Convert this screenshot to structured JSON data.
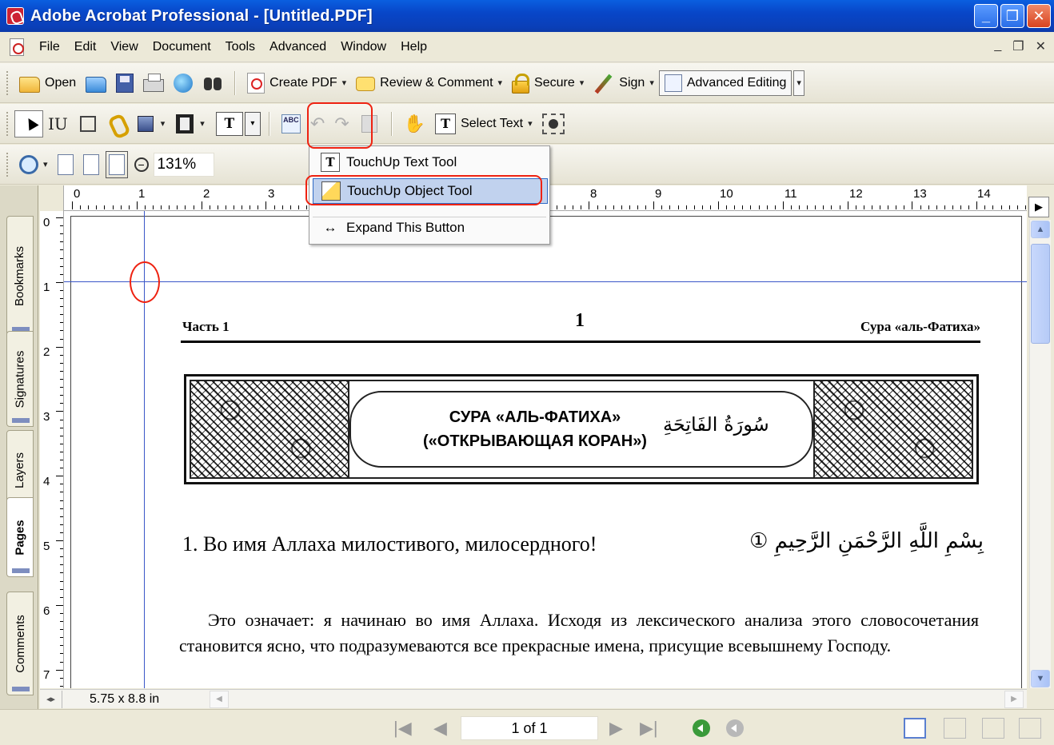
{
  "window": {
    "title": "Adobe Acrobat Professional - [Untitled.PDF]",
    "controls": {
      "minimize": "_",
      "restore": "❐",
      "close": "✕"
    }
  },
  "menu": [
    "File",
    "Edit",
    "View",
    "Document",
    "Tools",
    "Advanced",
    "Window",
    "Help"
  ],
  "mdi_controls": {
    "minimize": "_",
    "restore": "❐",
    "close": "✕"
  },
  "toolbar1": {
    "open": "Open",
    "create_pdf": "Create PDF",
    "review_comment": "Review & Comment",
    "secure": "Secure",
    "sign": "Sign",
    "advanced_editing": "Advanced Editing",
    "caret": "▾"
  },
  "toolbar2": {
    "select_text": "Select Text",
    "spell_label": "ABC"
  },
  "toolbar3": {
    "zoom_value": "131%"
  },
  "dropdown": {
    "items": [
      {
        "label": "TouchUp Text Tool",
        "icon": "T"
      },
      {
        "label": "TouchUp Object Tool",
        "icon": ""
      },
      {
        "label": "Expand This Button",
        "icon": "↔"
      }
    ]
  },
  "nav_tabs": [
    "Bookmarks",
    "Signatures",
    "Layers",
    "Pages",
    "Comments"
  ],
  "ruler": {
    "h_numbers": [
      "0",
      "1",
      "2",
      "3",
      "8",
      "9",
      "10",
      "11",
      "12",
      "13",
      "14"
    ],
    "v_numbers": [
      "0",
      "1",
      "2",
      "3",
      "4",
      "5",
      "6",
      "7"
    ]
  },
  "document": {
    "header_left": "Часть 1",
    "header_page": "1",
    "header_right": "Сура «аль-Фатиха»",
    "banner_line1": "СУРА «АЛЬ-ФАТИХА»",
    "banner_line2": "(«ОТКРЫВАЮЩАЯ КОРАН»)",
    "banner_arabic": "سُورَةُ الفَاتِحَةِ",
    "verse": "1. Во имя Аллаха милостивого, милосердного!",
    "verse_arabic": "بِسْمِ اللَّهِ الرَّحْمَنِ الرَّحِيمِ ①",
    "paragraph": "Это означает: я начинаю во имя Аллаха. Исходя из лексического анализа этого словосочетания становится ясно, что подразумеваются все прекрасные имена, присущие всевышнему Господу."
  },
  "status": {
    "page_size": "5.75 x 8.8 in",
    "page_of": "1 of 1"
  },
  "colors": {
    "titlebar": "#0846c8",
    "annotation": "#e21",
    "guide": "#3a57c8",
    "menu_highlight": "#c1d2ee"
  }
}
